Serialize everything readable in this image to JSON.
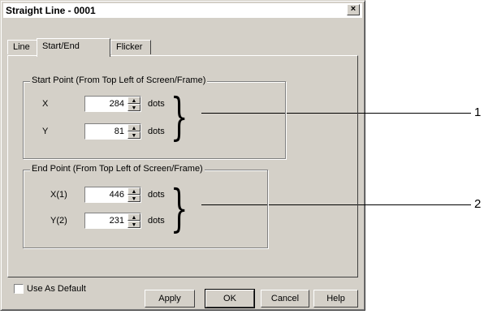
{
  "window": {
    "title": "Straight Line - 0001",
    "close_glyph": "×"
  },
  "tabs": [
    {
      "label": "Line"
    },
    {
      "label": "Start/End"
    },
    {
      "label": "Flicker"
    }
  ],
  "start_point": {
    "group_label": "Start Point (From Top Left of Screen/Frame)",
    "x": {
      "label": "X",
      "value": "284",
      "unit": "dots"
    },
    "y": {
      "label": "Y",
      "value": "81",
      "unit": "dots"
    }
  },
  "end_point": {
    "group_label": "End Point (From Top Left of Screen/Frame)",
    "x": {
      "label": "X(1)",
      "value": "446",
      "unit": "dots"
    },
    "y": {
      "label": "Y(2)",
      "value": "231",
      "unit": "dots"
    }
  },
  "callouts": [
    "1",
    "2"
  ],
  "use_as_default": {
    "label": "Use As Default",
    "checked": false
  },
  "buttons": {
    "apply": "Apply",
    "ok": "OK",
    "cancel": "Cancel",
    "help": "Help"
  }
}
